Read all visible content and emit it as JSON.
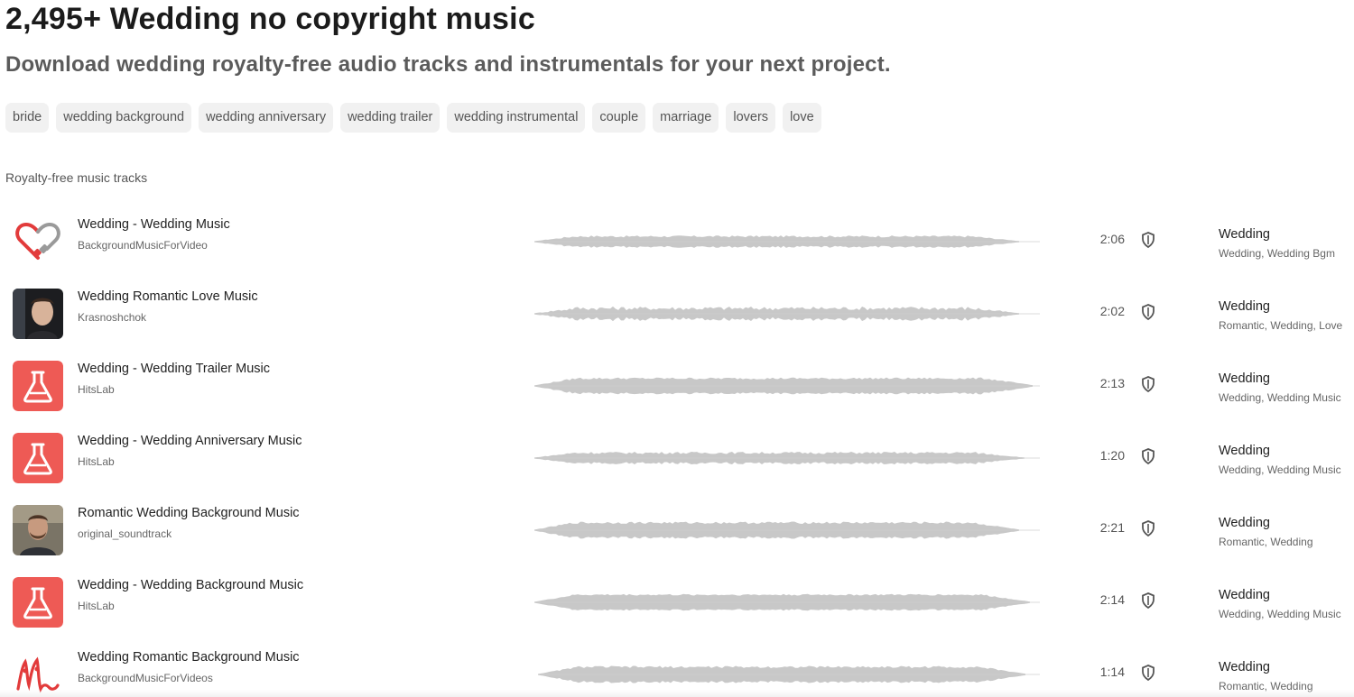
{
  "header": {
    "title": "2,495+ Wedding no copyright music",
    "subtitle": "Download wedding royalty-free audio tracks and instrumentals for your next project."
  },
  "tags": [
    "bride",
    "wedding background",
    "wedding anniversary",
    "wedding trailer",
    "wedding instrumental",
    "couple",
    "marriage",
    "lovers",
    "love"
  ],
  "section_label": "Royalty-free music tracks",
  "colors": {
    "accent": "#e9534f",
    "waveform": "#c8c8c8",
    "tag_bg": "#f1f1f1"
  },
  "tracks": [
    {
      "title": "Wedding - Wedding Music",
      "artist": "BackgroundMusicForVideo",
      "duration": "2:06",
      "genre": "Wedding",
      "tags": "Wedding, Wedding Bgm",
      "thumb": "heart-plug-icon"
    },
    {
      "title": "Wedding Romantic Love Music",
      "artist": "Krasnoshchok",
      "duration": "2:02",
      "genre": "Wedding",
      "tags": "Romantic, Wedding, Love",
      "thumb": "person-photo"
    },
    {
      "title": "Wedding - Wedding Trailer Music",
      "artist": "HitsLab",
      "duration": "2:13",
      "genre": "Wedding",
      "tags": "Wedding, Wedding Music",
      "thumb": "flask-icon"
    },
    {
      "title": "Wedding - Wedding Anniversary Music",
      "artist": "HitsLab",
      "duration": "1:20",
      "genre": "Wedding",
      "tags": "Wedding, Wedding Music",
      "thumb": "flask-icon"
    },
    {
      "title": "Romantic Wedding Background Music",
      "artist": "original_soundtrack",
      "duration": "2:21",
      "genre": "Wedding",
      "tags": "Romantic, Wedding",
      "thumb": "person-photo"
    },
    {
      "title": "Wedding - Wedding Background Music",
      "artist": "HitsLab",
      "duration": "2:14",
      "genre": "Wedding",
      "tags": "Wedding, Wedding Music",
      "thumb": "flask-icon"
    },
    {
      "title": "Wedding Romantic Background Music",
      "artist": "BackgroundMusicForVideos",
      "duration": "1:14",
      "genre": "Wedding",
      "tags": "Romantic, Wedding",
      "thumb": "m-logo-icon"
    }
  ]
}
